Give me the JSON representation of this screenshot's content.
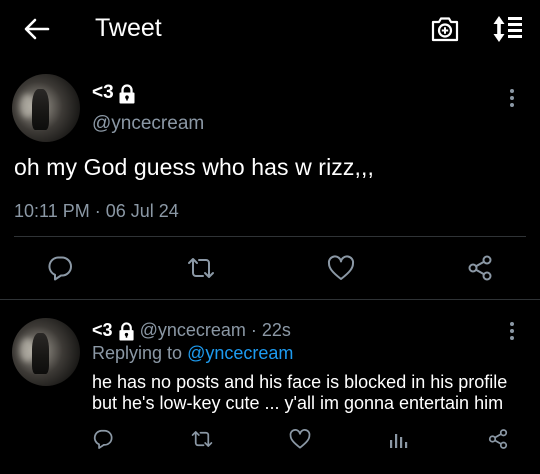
{
  "header": {
    "title": "Tweet",
    "back_icon": "arrow-left-icon",
    "camera_icon": "camera-add-icon",
    "sort_icon": "sort-list-icon"
  },
  "tweet": {
    "display_name": "<3",
    "handle": "@yncecream",
    "text": "oh my God guess who has w rizz,,,",
    "time": "10:11 PM",
    "separator": "·",
    "date": "06 Jul 24",
    "actions": [
      "reply-icon",
      "retweet-icon",
      "like-icon",
      "share-icon"
    ]
  },
  "reply": {
    "display_name": "<3",
    "handle": "@yncecream",
    "separator": "·",
    "age": "22s",
    "replying_label": "Replying to",
    "replying_to": "@yncecream",
    "text_line1": "he has no posts and his face is blocked in his profile",
    "text_line2": "but he's low-key cute ... y'all im gonna entertain him",
    "actions": [
      "reply-icon",
      "retweet-icon",
      "like-icon",
      "views-icon",
      "share-icon"
    ]
  },
  "colors": {
    "background": "#000000",
    "text": "#ffffff",
    "secondary": "#8b98a5",
    "link": "#1d9bf0",
    "divider": "#2f3336"
  }
}
